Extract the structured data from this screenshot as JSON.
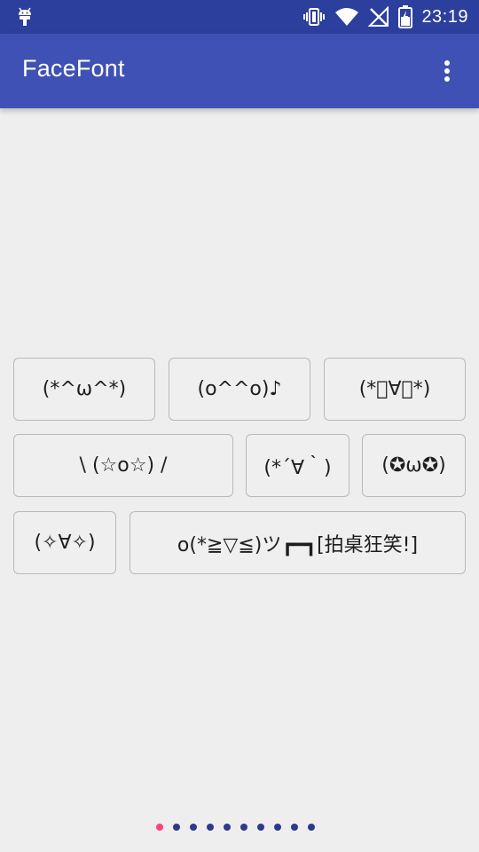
{
  "status_bar": {
    "time": "23:19",
    "icons": [
      "android-icon",
      "vibrate-icon",
      "wifi-icon",
      "no-sim-icon",
      "battery-icon"
    ]
  },
  "app_bar": {
    "title": "FaceFont",
    "overflow_icon": "more-vert-icon"
  },
  "emoticons": [
    "(*^ω^*)",
    "(o^^o)♪",
    "(*ﾟ∀ﾟ*)",
    "\\ (☆o☆) /",
    "(*´∀｀)",
    "(✪ω✪)",
    "(✧∀✧)",
    "o(*≧▽≦)ツ┏━┓[拍桌狂笑!]"
  ],
  "pager": {
    "page_count": 10,
    "current_page": 1
  },
  "colors": {
    "status_bar": "#2d3f9c",
    "app_bar": "#3f51b5",
    "background": "#eeeeef",
    "dot_active": "#ff4081",
    "dot_inactive": "#2d3a8c"
  }
}
